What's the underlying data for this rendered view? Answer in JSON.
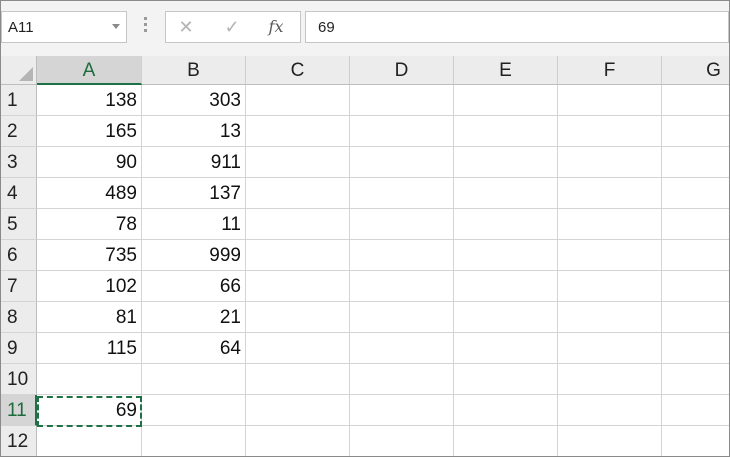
{
  "name_box": {
    "value": "A11"
  },
  "formula_bar": {
    "cancel_icon": "close-icon",
    "enter_icon": "check-icon",
    "function_label": "fx",
    "value": "69"
  },
  "columns": [
    "A",
    "B",
    "C",
    "D",
    "E",
    "F",
    "G"
  ],
  "rows": [
    "1",
    "2",
    "3",
    "4",
    "5",
    "6",
    "7",
    "8",
    "9",
    "10",
    "11",
    "12"
  ],
  "cells": {
    "A": [
      "138",
      "165",
      "90",
      "489",
      "78",
      "735",
      "102",
      "81",
      "115",
      "",
      "69",
      ""
    ],
    "B": [
      "303",
      "13",
      "911",
      "137",
      "11",
      "999",
      "66",
      "21",
      "64",
      "",
      "",
      ""
    ]
  },
  "selection": {
    "active_cell": "A11",
    "copy_marquee": true
  },
  "colors": {
    "accent": "#1e7145"
  }
}
